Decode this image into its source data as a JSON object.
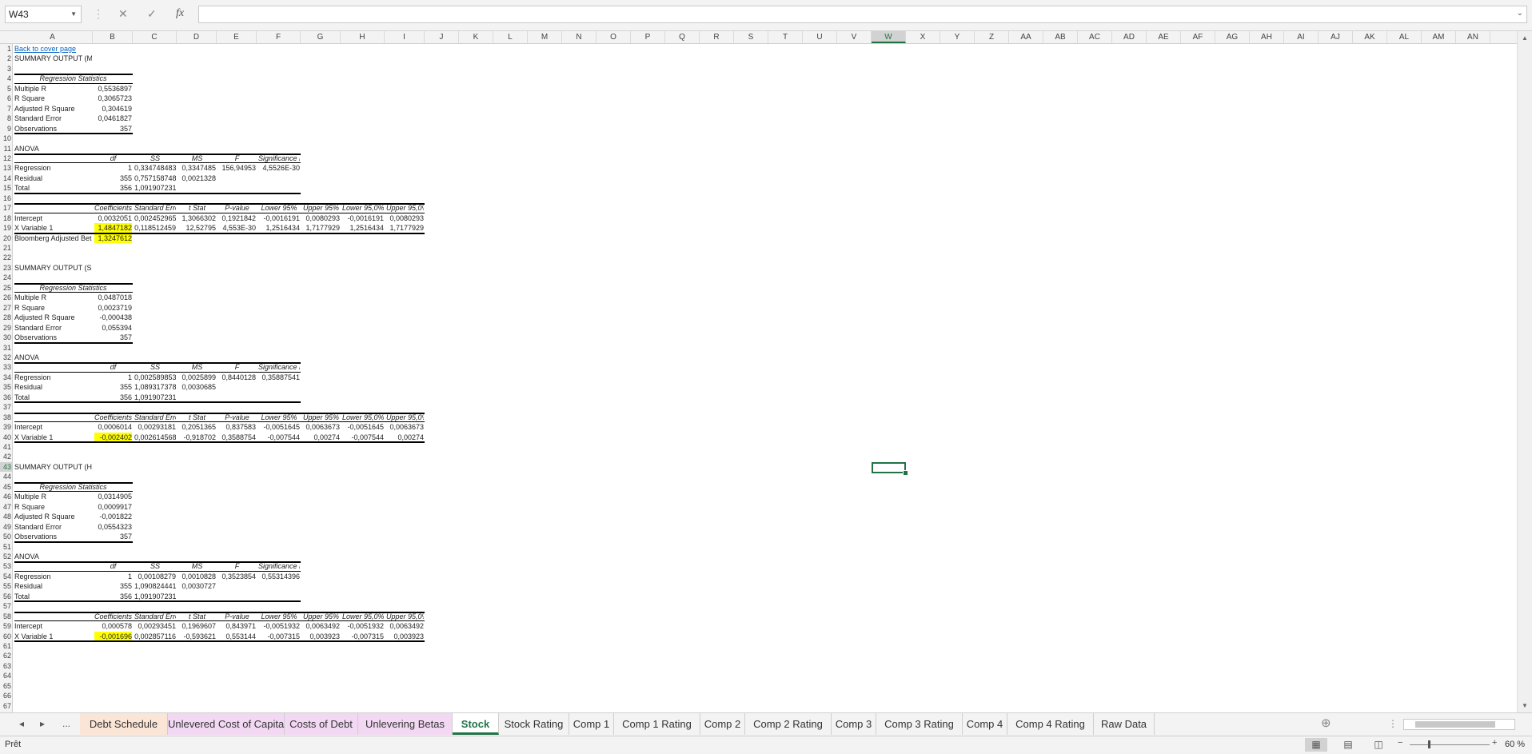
{
  "formula_bar": {
    "name_box": "W43",
    "cancel_icon": "✕",
    "enter_icon": "✓",
    "fx_label": "fx",
    "formula": ""
  },
  "columns": [
    "A",
    "B",
    "C",
    "D",
    "E",
    "F",
    "G",
    "H",
    "I",
    "J",
    "K",
    "L",
    "M",
    "N",
    "O",
    "P",
    "Q",
    "R",
    "S",
    "T",
    "U",
    "V",
    "W",
    "X",
    "Y",
    "Z",
    "AA",
    "AB",
    "AC",
    "AD",
    "AE",
    "AF",
    "AG",
    "AH",
    "AI",
    "AJ",
    "AK",
    "AL",
    "AM",
    "AN"
  ],
  "selected_column": "W",
  "selected_row": 43,
  "cells": [
    {
      "r": 1,
      "c": "A",
      "v": "Back to cover page",
      "cls": "link"
    },
    {
      "r": 2,
      "c": "A",
      "v": "SUMMARY OUTPUT (MRP)"
    },
    {
      "r": 4,
      "c": "A",
      "v": "Regression Statistics",
      "cls": "it",
      "span": 2
    },
    {
      "r": 5,
      "c": "A",
      "v": "Multiple R"
    },
    {
      "r": 5,
      "c": "B",
      "v": "0,5536897",
      "cls": "num"
    },
    {
      "r": 6,
      "c": "A",
      "v": "R Square"
    },
    {
      "r": 6,
      "c": "B",
      "v": "0,3065723",
      "cls": "num"
    },
    {
      "r": 7,
      "c": "A",
      "v": "Adjusted R Square"
    },
    {
      "r": 7,
      "c": "B",
      "v": "0,304619",
      "cls": "num"
    },
    {
      "r": 8,
      "c": "A",
      "v": "Standard Error"
    },
    {
      "r": 8,
      "c": "B",
      "v": "0,0461827",
      "cls": "num"
    },
    {
      "r": 9,
      "c": "A",
      "v": "Observations"
    },
    {
      "r": 9,
      "c": "B",
      "v": "357",
      "cls": "num"
    },
    {
      "r": 11,
      "c": "A",
      "v": "ANOVA"
    },
    {
      "r": 12,
      "c": "B",
      "v": "df",
      "cls": "it"
    },
    {
      "r": 12,
      "c": "C",
      "v": "SS",
      "cls": "it"
    },
    {
      "r": 12,
      "c": "D",
      "v": "MS",
      "cls": "it"
    },
    {
      "r": 12,
      "c": "E",
      "v": "F",
      "cls": "it"
    },
    {
      "r": 12,
      "c": "F",
      "v": "Significance F",
      "cls": "it"
    },
    {
      "r": 13,
      "c": "A",
      "v": "Regression"
    },
    {
      "r": 13,
      "c": "B",
      "v": "1",
      "cls": "num"
    },
    {
      "r": 13,
      "c": "C",
      "v": "0,334748483",
      "cls": "num"
    },
    {
      "r": 13,
      "c": "D",
      "v": "0,3347485",
      "cls": "num"
    },
    {
      "r": 13,
      "c": "E",
      "v": "156,94953",
      "cls": "num"
    },
    {
      "r": 13,
      "c": "F",
      "v": "4,5526E-30",
      "cls": "num"
    },
    {
      "r": 14,
      "c": "A",
      "v": "Residual"
    },
    {
      "r": 14,
      "c": "B",
      "v": "355",
      "cls": "num"
    },
    {
      "r": 14,
      "c": "C",
      "v": "0,757158748",
      "cls": "num"
    },
    {
      "r": 14,
      "c": "D",
      "v": "0,0021328",
      "cls": "num"
    },
    {
      "r": 15,
      "c": "A",
      "v": "Total"
    },
    {
      "r": 15,
      "c": "B",
      "v": "356",
      "cls": "num"
    },
    {
      "r": 15,
      "c": "C",
      "v": "1,091907231",
      "cls": "num"
    },
    {
      "r": 17,
      "c": "B",
      "v": "Coefficients",
      "cls": "it"
    },
    {
      "r": 17,
      "c": "C",
      "v": "Standard Error",
      "cls": "it"
    },
    {
      "r": 17,
      "c": "D",
      "v": "t Stat",
      "cls": "it"
    },
    {
      "r": 17,
      "c": "E",
      "v": "P-value",
      "cls": "it"
    },
    {
      "r": 17,
      "c": "F",
      "v": "Lower 95%",
      "cls": "it"
    },
    {
      "r": 17,
      "c": "G",
      "v": "Upper 95%",
      "cls": "it"
    },
    {
      "r": 17,
      "c": "H",
      "v": "Lower 95,0%",
      "cls": "it"
    },
    {
      "r": 17,
      "c": "I",
      "v": "Upper 95,0%",
      "cls": "it"
    },
    {
      "r": 18,
      "c": "A",
      "v": "Intercept"
    },
    {
      "r": 18,
      "c": "B",
      "v": "0,0032051",
      "cls": "num"
    },
    {
      "r": 18,
      "c": "C",
      "v": "0,002452965",
      "cls": "num"
    },
    {
      "r": 18,
      "c": "D",
      "v": "1,3066302",
      "cls": "num"
    },
    {
      "r": 18,
      "c": "E",
      "v": "0,1921842",
      "cls": "num"
    },
    {
      "r": 18,
      "c": "F",
      "v": "-0,0016191",
      "cls": "num"
    },
    {
      "r": 18,
      "c": "G",
      "v": "0,0080293",
      "cls": "num"
    },
    {
      "r": 18,
      "c": "H",
      "v": "-0,0016191",
      "cls": "num"
    },
    {
      "r": 18,
      "c": "I",
      "v": "0,0080293",
      "cls": "num"
    },
    {
      "r": 19,
      "c": "A",
      "v": "X Variable 1"
    },
    {
      "r": 19,
      "c": "B",
      "v": "1,4847182",
      "cls": "num hi"
    },
    {
      "r": 19,
      "c": "C",
      "v": "0,118512459",
      "cls": "num"
    },
    {
      "r": 19,
      "c": "D",
      "v": "12,52795",
      "cls": "num"
    },
    {
      "r": 19,
      "c": "E",
      "v": "4,553E-30",
      "cls": "num"
    },
    {
      "r": 19,
      "c": "F",
      "v": "1,2516434",
      "cls": "num"
    },
    {
      "r": 19,
      "c": "G",
      "v": "1,7177929",
      "cls": "num"
    },
    {
      "r": 19,
      "c": "H",
      "v": "1,2516434",
      "cls": "num"
    },
    {
      "r": 19,
      "c": "I",
      "v": "1,7177929",
      "cls": "num"
    },
    {
      "r": 20,
      "c": "A",
      "v": "Bloomberg Adjusted Beta"
    },
    {
      "r": 20,
      "c": "B",
      "v": "1,3247612",
      "cls": "num hi"
    },
    {
      "r": 23,
      "c": "A",
      "v": "SUMMARY OUTPUT (SMB)"
    },
    {
      "r": 25,
      "c": "A",
      "v": "Regression Statistics",
      "cls": "it",
      "span": 2
    },
    {
      "r": 26,
      "c": "A",
      "v": "Multiple R"
    },
    {
      "r": 26,
      "c": "B",
      "v": "0,0487018",
      "cls": "num"
    },
    {
      "r": 27,
      "c": "A",
      "v": "R Square"
    },
    {
      "r": 27,
      "c": "B",
      "v": "0,0023719",
      "cls": "num"
    },
    {
      "r": 28,
      "c": "A",
      "v": "Adjusted R Square"
    },
    {
      "r": 28,
      "c": "B",
      "v": "-0,000438",
      "cls": "num"
    },
    {
      "r": 29,
      "c": "A",
      "v": "Standard Error"
    },
    {
      "r": 29,
      "c": "B",
      "v": "0,055394",
      "cls": "num"
    },
    {
      "r": 30,
      "c": "A",
      "v": "Observations"
    },
    {
      "r": 30,
      "c": "B",
      "v": "357",
      "cls": "num"
    },
    {
      "r": 32,
      "c": "A",
      "v": "ANOVA"
    },
    {
      "r": 33,
      "c": "B",
      "v": "df",
      "cls": "it"
    },
    {
      "r": 33,
      "c": "C",
      "v": "SS",
      "cls": "it"
    },
    {
      "r": 33,
      "c": "D",
      "v": "MS",
      "cls": "it"
    },
    {
      "r": 33,
      "c": "E",
      "v": "F",
      "cls": "it"
    },
    {
      "r": 33,
      "c": "F",
      "v": "Significance F",
      "cls": "it"
    },
    {
      "r": 34,
      "c": "A",
      "v": "Regression"
    },
    {
      "r": 34,
      "c": "B",
      "v": "1",
      "cls": "num"
    },
    {
      "r": 34,
      "c": "C",
      "v": "0,002589853",
      "cls": "num"
    },
    {
      "r": 34,
      "c": "D",
      "v": "0,0025899",
      "cls": "num"
    },
    {
      "r": 34,
      "c": "E",
      "v": "0,8440128",
      "cls": "num"
    },
    {
      "r": 34,
      "c": "F",
      "v": "0,35887541",
      "cls": "num"
    },
    {
      "r": 35,
      "c": "A",
      "v": "Residual"
    },
    {
      "r": 35,
      "c": "B",
      "v": "355",
      "cls": "num"
    },
    {
      "r": 35,
      "c": "C",
      "v": "1,089317378",
      "cls": "num"
    },
    {
      "r": 35,
      "c": "D",
      "v": "0,0030685",
      "cls": "num"
    },
    {
      "r": 36,
      "c": "A",
      "v": "Total"
    },
    {
      "r": 36,
      "c": "B",
      "v": "356",
      "cls": "num"
    },
    {
      "r": 36,
      "c": "C",
      "v": "1,091907231",
      "cls": "num"
    },
    {
      "r": 38,
      "c": "B",
      "v": "Coefficients",
      "cls": "it"
    },
    {
      "r": 38,
      "c": "C",
      "v": "Standard Error",
      "cls": "it"
    },
    {
      "r": 38,
      "c": "D",
      "v": "t Stat",
      "cls": "it"
    },
    {
      "r": 38,
      "c": "E",
      "v": "P-value",
      "cls": "it"
    },
    {
      "r": 38,
      "c": "F",
      "v": "Lower 95%",
      "cls": "it"
    },
    {
      "r": 38,
      "c": "G",
      "v": "Upper 95%",
      "cls": "it"
    },
    {
      "r": 38,
      "c": "H",
      "v": "Lower 95,0%",
      "cls": "it"
    },
    {
      "r": 38,
      "c": "I",
      "v": "Upper 95,0%",
      "cls": "it"
    },
    {
      "r": 39,
      "c": "A",
      "v": "Intercept"
    },
    {
      "r": 39,
      "c": "B",
      "v": "0,0006014",
      "cls": "num"
    },
    {
      "r": 39,
      "c": "C",
      "v": "0,00293181",
      "cls": "num"
    },
    {
      "r": 39,
      "c": "D",
      "v": "0,2051365",
      "cls": "num"
    },
    {
      "r": 39,
      "c": "E",
      "v": "0,837583",
      "cls": "num"
    },
    {
      "r": 39,
      "c": "F",
      "v": "-0,0051645",
      "cls": "num"
    },
    {
      "r": 39,
      "c": "G",
      "v": "0,0063673",
      "cls": "num"
    },
    {
      "r": 39,
      "c": "H",
      "v": "-0,0051645",
      "cls": "num"
    },
    {
      "r": 39,
      "c": "I",
      "v": "0,0063673",
      "cls": "num"
    },
    {
      "r": 40,
      "c": "A",
      "v": "X Variable 1"
    },
    {
      "r": 40,
      "c": "B",
      "v": "-0,002402",
      "cls": "num hi"
    },
    {
      "r": 40,
      "c": "C",
      "v": "0,002614568",
      "cls": "num"
    },
    {
      "r": 40,
      "c": "D",
      "v": "-0,918702",
      "cls": "num"
    },
    {
      "r": 40,
      "c": "E",
      "v": "0,3588754",
      "cls": "num"
    },
    {
      "r": 40,
      "c": "F",
      "v": "-0,007544",
      "cls": "num"
    },
    {
      "r": 40,
      "c": "G",
      "v": "0,00274",
      "cls": "num"
    },
    {
      "r": 40,
      "c": "H",
      "v": "-0,007544",
      "cls": "num"
    },
    {
      "r": 40,
      "c": "I",
      "v": "0,00274",
      "cls": "num"
    },
    {
      "r": 43,
      "c": "A",
      "v": "SUMMARY OUTPUT (HML)"
    },
    {
      "r": 45,
      "c": "A",
      "v": "Regression Statistics",
      "cls": "it",
      "span": 2
    },
    {
      "r": 46,
      "c": "A",
      "v": "Multiple R"
    },
    {
      "r": 46,
      "c": "B",
      "v": "0,0314905",
      "cls": "num"
    },
    {
      "r": 47,
      "c": "A",
      "v": "R Square"
    },
    {
      "r": 47,
      "c": "B",
      "v": "0,0009917",
      "cls": "num"
    },
    {
      "r": 48,
      "c": "A",
      "v": "Adjusted R Square"
    },
    {
      "r": 48,
      "c": "B",
      "v": "-0,001822",
      "cls": "num"
    },
    {
      "r": 49,
      "c": "A",
      "v": "Standard Error"
    },
    {
      "r": 49,
      "c": "B",
      "v": "0,0554323",
      "cls": "num"
    },
    {
      "r": 50,
      "c": "A",
      "v": "Observations"
    },
    {
      "r": 50,
      "c": "B",
      "v": "357",
      "cls": "num"
    },
    {
      "r": 52,
      "c": "A",
      "v": "ANOVA"
    },
    {
      "r": 53,
      "c": "B",
      "v": "df",
      "cls": "it"
    },
    {
      "r": 53,
      "c": "C",
      "v": "SS",
      "cls": "it"
    },
    {
      "r": 53,
      "c": "D",
      "v": "MS",
      "cls": "it"
    },
    {
      "r": 53,
      "c": "E",
      "v": "F",
      "cls": "it"
    },
    {
      "r": 53,
      "c": "F",
      "v": "Significance F",
      "cls": "it"
    },
    {
      "r": 54,
      "c": "A",
      "v": "Regression"
    },
    {
      "r": 54,
      "c": "B",
      "v": "1",
      "cls": "num"
    },
    {
      "r": 54,
      "c": "C",
      "v": "0,00108279",
      "cls": "num"
    },
    {
      "r": 54,
      "c": "D",
      "v": "0,0010828",
      "cls": "num"
    },
    {
      "r": 54,
      "c": "E",
      "v": "0,3523854",
      "cls": "num"
    },
    {
      "r": 54,
      "c": "F",
      "v": "0,55314396",
      "cls": "num"
    },
    {
      "r": 55,
      "c": "A",
      "v": "Residual"
    },
    {
      "r": 55,
      "c": "B",
      "v": "355",
      "cls": "num"
    },
    {
      "r": 55,
      "c": "C",
      "v": "1,090824441",
      "cls": "num"
    },
    {
      "r": 55,
      "c": "D",
      "v": "0,0030727",
      "cls": "num"
    },
    {
      "r": 56,
      "c": "A",
      "v": "Total"
    },
    {
      "r": 56,
      "c": "B",
      "v": "356",
      "cls": "num"
    },
    {
      "r": 56,
      "c": "C",
      "v": "1,091907231",
      "cls": "num"
    },
    {
      "r": 58,
      "c": "B",
      "v": "Coefficients",
      "cls": "it"
    },
    {
      "r": 58,
      "c": "C",
      "v": "Standard Error",
      "cls": "it"
    },
    {
      "r": 58,
      "c": "D",
      "v": "t Stat",
      "cls": "it"
    },
    {
      "r": 58,
      "c": "E",
      "v": "P-value",
      "cls": "it"
    },
    {
      "r": 58,
      "c": "F",
      "v": "Lower 95%",
      "cls": "it"
    },
    {
      "r": 58,
      "c": "G",
      "v": "Upper 95%",
      "cls": "it"
    },
    {
      "r": 58,
      "c": "H",
      "v": "Lower 95,0%",
      "cls": "it"
    },
    {
      "r": 58,
      "c": "I",
      "v": "Upper 95,0%",
      "cls": "it"
    },
    {
      "r": 59,
      "c": "A",
      "v": "Intercept"
    },
    {
      "r": 59,
      "c": "B",
      "v": "0,000578",
      "cls": "num"
    },
    {
      "r": 59,
      "c": "C",
      "v": "0,00293451",
      "cls": "num"
    },
    {
      "r": 59,
      "c": "D",
      "v": "0,1969607",
      "cls": "num"
    },
    {
      "r": 59,
      "c": "E",
      "v": "0,843971",
      "cls": "num"
    },
    {
      "r": 59,
      "c": "F",
      "v": "-0,0051932",
      "cls": "num"
    },
    {
      "r": 59,
      "c": "G",
      "v": "0,0063492",
      "cls": "num"
    },
    {
      "r": 59,
      "c": "H",
      "v": "-0,0051932",
      "cls": "num"
    },
    {
      "r": 59,
      "c": "I",
      "v": "0,0063492",
      "cls": "num"
    },
    {
      "r": 60,
      "c": "A",
      "v": "X Variable 1"
    },
    {
      "r": 60,
      "c": "B",
      "v": "-0,001696",
      "cls": "num hi"
    },
    {
      "r": 60,
      "c": "C",
      "v": "0,002857116",
      "cls": "num"
    },
    {
      "r": 60,
      "c": "D",
      "v": "-0,593621",
      "cls": "num"
    },
    {
      "r": 60,
      "c": "E",
      "v": "0,553144",
      "cls": "num"
    },
    {
      "r": 60,
      "c": "F",
      "v": "-0,007315",
      "cls": "num"
    },
    {
      "r": 60,
      "c": "G",
      "v": "0,003923",
      "cls": "num"
    },
    {
      "r": 60,
      "c": "H",
      "v": "-0,007315",
      "cls": "num"
    },
    {
      "r": 60,
      "c": "I",
      "v": "0,003923",
      "cls": "num"
    }
  ],
  "table_borders": [
    {
      "from": "A",
      "to": "B",
      "rows": [
        4,
        9
      ]
    },
    {
      "from": "A",
      "to": "F",
      "rows": [
        12,
        15
      ]
    },
    {
      "from": "A",
      "to": "I",
      "rows": [
        17,
        19
      ]
    },
    {
      "from": "A",
      "to": "B",
      "rows": [
        25,
        30
      ]
    },
    {
      "from": "A",
      "to": "F",
      "rows": [
        33,
        36
      ]
    },
    {
      "from": "A",
      "to": "I",
      "rows": [
        38,
        40
      ]
    },
    {
      "from": "A",
      "to": "B",
      "rows": [
        45,
        50
      ]
    },
    {
      "from": "A",
      "to": "F",
      "rows": [
        53,
        56
      ]
    },
    {
      "from": "A",
      "to": "I",
      "rows": [
        58,
        60
      ]
    }
  ],
  "sheet_tabs": [
    {
      "label": "Debt Schedule",
      "color": "#fbe5d6"
    },
    {
      "label": "Unlevered Cost of Capital",
      "color": "#f3d8f3"
    },
    {
      "label": "Costs of Debt",
      "color": "#f3d8f3"
    },
    {
      "label": "Unlevering Betas",
      "color": "#f3d8f3"
    },
    {
      "label": "Stock",
      "color": "#ffffff",
      "active": true
    },
    {
      "label": "Stock Rating",
      "color": ""
    },
    {
      "label": "Comp 1",
      "color": ""
    },
    {
      "label": "Comp 1 Rating",
      "color": ""
    },
    {
      "label": "Comp 2",
      "color": ""
    },
    {
      "label": "Comp 2 Rating",
      "color": ""
    },
    {
      "label": "Comp 3",
      "color": ""
    },
    {
      "label": "Comp 3 Rating",
      "color": ""
    },
    {
      "label": "Comp 4",
      "color": ""
    },
    {
      "label": "Comp 4 Rating",
      "color": ""
    },
    {
      "label": "Raw Data",
      "color": ""
    }
  ],
  "tab_nav": {
    "prev": "◂",
    "next": "▸",
    "more": "...",
    "add": "⊕"
  },
  "status": {
    "text": "Prêt",
    "zoom": "60 %"
  },
  "colors": {
    "accent": "#217346",
    "highlight": "#ffff00",
    "link": "#0563c1"
  }
}
